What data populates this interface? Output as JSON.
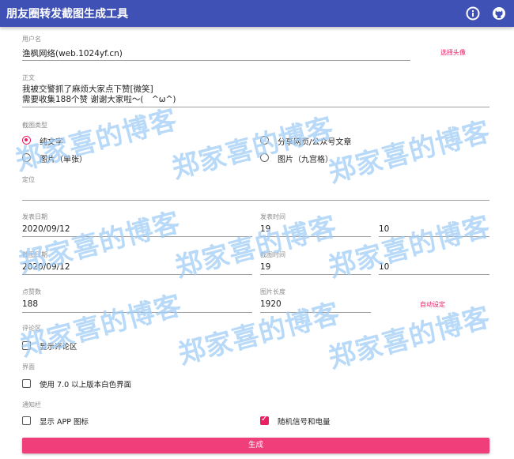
{
  "app": {
    "title": "朋友圈转发截图生成工具"
  },
  "icons": {
    "info": "info-icon",
    "github": "github-icon"
  },
  "form": {
    "username": {
      "label": "用户名",
      "value": "渔枫网络(web.1024yf.cn)",
      "avatar_button": "选择头像"
    },
    "content": {
      "label": "正文",
      "line1": "我被交警抓了麻烦大家点下赞[微笑]",
      "line2": "需要收集188个赞 谢谢大家啦～(　^ω^)"
    },
    "type": {
      "label": "截图类型",
      "options": [
        "纯文字",
        "分享网页/公众号文章",
        "图片（单张）",
        "图片（九宫格）"
      ],
      "selected": "纯文字"
    },
    "location": {
      "label": "定位",
      "value": ""
    },
    "post_date": {
      "label": "发表日期",
      "value": "2020/09/12"
    },
    "post_time": {
      "label": "发表时间",
      "hour": "19",
      "minute": "10"
    },
    "shot_date": {
      "label": "截图日期",
      "value": "2020/09/12"
    },
    "shot_time": {
      "label": "截图时间",
      "hour": "19",
      "minute": "10"
    },
    "likes": {
      "label": "点赞数",
      "value": "188"
    },
    "img_length": {
      "label": "图片长度",
      "value": "1920",
      "auto_button": "自动设定"
    },
    "comments": {
      "label": "评论区",
      "checkbox": "显示评论区",
      "checked": false
    },
    "ui": {
      "label": "界面",
      "checkbox": "使用 7.0 以上版本白色界面",
      "checked": false
    },
    "notify": {
      "label": "通知栏",
      "app_icon": "显示 APP 图标",
      "app_icon_checked": false,
      "signal": "随机信号和电量",
      "signal_checked": true
    }
  },
  "generate_button": "生成",
  "watermark": "郑家喜的博客",
  "colors": {
    "primary": "#3f51b5",
    "accent": "#e91e63"
  }
}
